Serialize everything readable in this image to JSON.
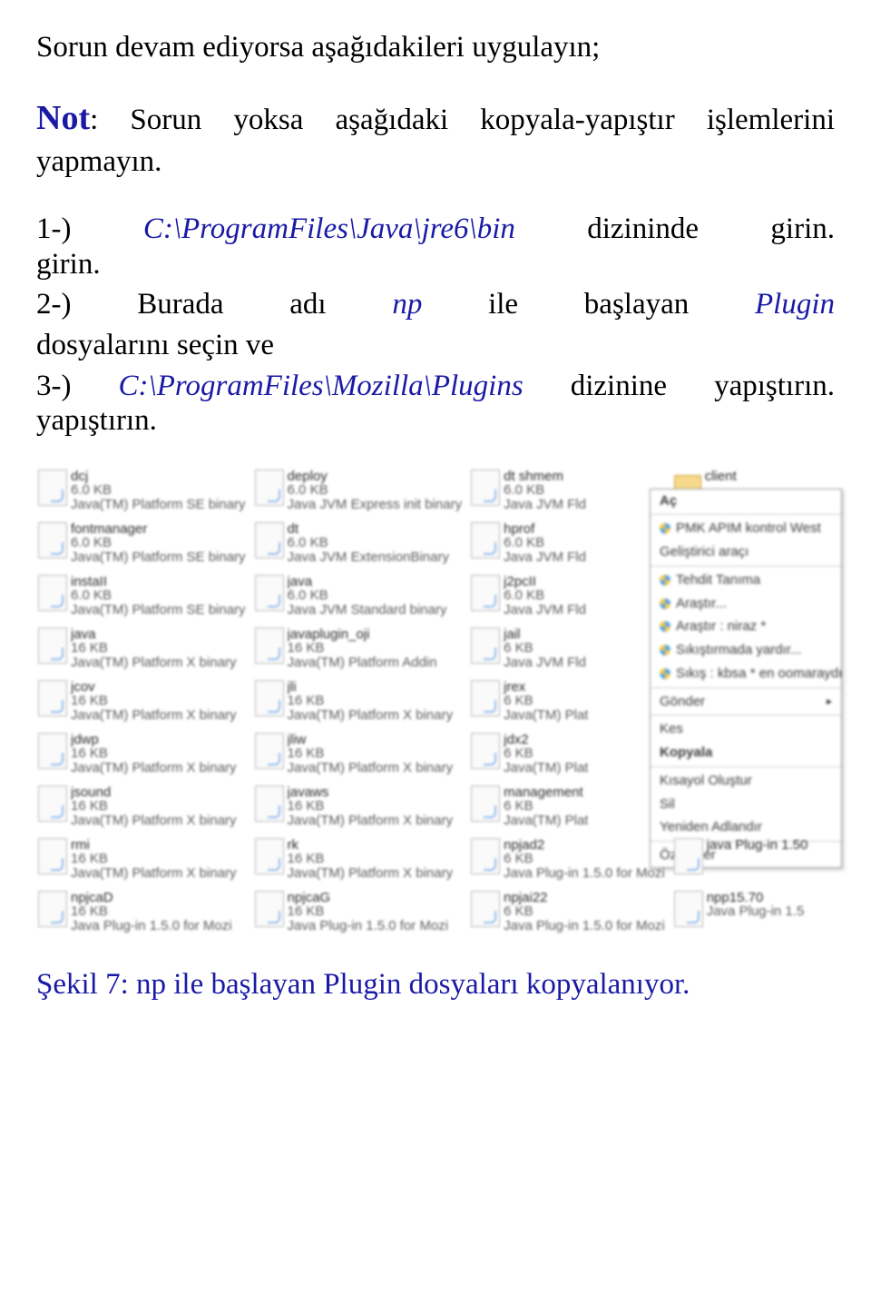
{
  "header": "Sorun devam ediyorsa aşağıdakileri uygulayın;",
  "note": {
    "label": "Not",
    "text": ": Sorun yoksa aşağıdaki kopyala-yapıştır işlemlerini yapmayın."
  },
  "steps": {
    "one_a": "1-)   ",
    "one_path": "C:\\ProgramFiles\\Java\\jre6\\bin",
    "one_b": "   dizininde girin.",
    "two_a": "2-)  Burada  adı  ",
    "two_np": "np",
    "two_b": "  ile  başlayan  ",
    "two_plugin": "Plugin",
    "two_c": " dosyalarını seçin ve",
    "three_a": "3-)   ",
    "three_path": "C:\\ProgramFiles\\Mozilla\\Plugins",
    "three_b": "   dizinine yapıştırın."
  },
  "caption": {
    "a": "Şekil  7:   np   ile   başlayan   Plugin   dosyaları kopyalanıyor."
  },
  "files": {
    "col1": [
      {
        "name": "dcj",
        "size": "6.0 KB",
        "type": "Java(TM) Platform SE binary"
      },
      {
        "name": "fontmanager",
        "size": "6.0 KB",
        "type": "Java(TM) Platform SE binary"
      },
      {
        "name": "instaII",
        "size": "6.0 KB",
        "type": "Java(TM) Platform SE binary"
      },
      {
        "name": "java",
        "size": "16 KB",
        "type": "Java(TM) Platform X binary"
      },
      {
        "name": "jcov",
        "size": "16 KB",
        "type": "Java(TM) Platform X binary"
      },
      {
        "name": "jdwp",
        "size": "16 KB",
        "type": "Java(TM) Platform X binary"
      },
      {
        "name": "jsound",
        "size": "16 KB",
        "type": "Java(TM) Platform X binary"
      },
      {
        "name": "rmi",
        "size": "16 KB",
        "type": "Java(TM) Platform X binary"
      },
      {
        "name": "npjcaD",
        "size": "16 KB",
        "type": "Java Plug-in 1.5.0 for Mozi"
      }
    ],
    "col2": [
      {
        "name": "deploy",
        "size": "6.0 KB",
        "type": "Java JVM Express init binary"
      },
      {
        "name": "dt",
        "size": "6.0 KB",
        "type": "Java JVM ExtensionBinary"
      },
      {
        "name": "java",
        "size": "6.0 KB",
        "type": "Java JVM Standard binary"
      },
      {
        "name": "javaplugin_oji",
        "size": "16 KB",
        "type": "Java(TM) Platform Addin"
      },
      {
        "name": "jli",
        "size": "16 KB",
        "type": "Java(TM) Platform X binary"
      },
      {
        "name": "jliw",
        "size": "16 KB",
        "type": "Java(TM) Platform X binary"
      },
      {
        "name": "javaws",
        "size": "16 KB",
        "type": "Java(TM) Platform X binary"
      },
      {
        "name": "rk",
        "size": "16 KB",
        "type": "Java(TM) Platform X binary"
      },
      {
        "name": "npjcaG",
        "size": "16 KB",
        "type": "Java Plug-in 1.5.0 for Mozi"
      }
    ],
    "col3": [
      {
        "name": "dt shmem",
        "size": "6.0 KB",
        "type": "Java JVM Fld"
      },
      {
        "name": "hprof",
        "size": "6.0 KB",
        "type": "Java JVM Fld"
      },
      {
        "name": "j2pcII",
        "size": "6.0 KB",
        "type": "Java JVM Fld"
      },
      {
        "name": "jail",
        "size": "6 KB",
        "type": "Java JVM Fld"
      },
      {
        "name": "jrex",
        "size": "6 KB",
        "type": "Java(TM) Plat"
      },
      {
        "name": "jdx2",
        "size": "6 KB",
        "type": "Java(TM) Plat"
      },
      {
        "name": "management",
        "size": "6 KB",
        "type": "Java(TM) Plat"
      },
      {
        "name": "npjad2",
        "size": "6 KB",
        "type": "Java Plug-in 1.5.0 for Mozi"
      },
      {
        "name": "npjai22",
        "size": "6 KB",
        "type": "Java Plug-in 1.5.0 for Mozi"
      }
    ],
    "col4_top": {
      "name": "client",
      "folder": true
    },
    "col4_bottom": [
      {
        "name": "java Plug-in 1.50",
        "size": "",
        "type": ""
      },
      {
        "name": "npp15.70",
        "size": "",
        "type": "Java Plug-in 1.5"
      }
    ]
  },
  "menu": {
    "open": "Aç",
    "newitem": "PMK APIM kontrol West",
    "compress": "Geliştirici araçı",
    "target": "Tehdit Tanıma",
    "research": "Araştır...",
    "researchnew": "Araştır : niraz *",
    "zipmake": "Sıkıştırmada yardır...",
    "ziprun": "Sıkış : kbsa * en oomaraydı",
    "sendto": "Gönder",
    "cut": "Kes",
    "copy": "Kopyala",
    "shortcut": "Kısayol Oluştur",
    "delete": "Sil",
    "rename": "Yeniden Adlandır",
    "properties": "Özellikler"
  }
}
